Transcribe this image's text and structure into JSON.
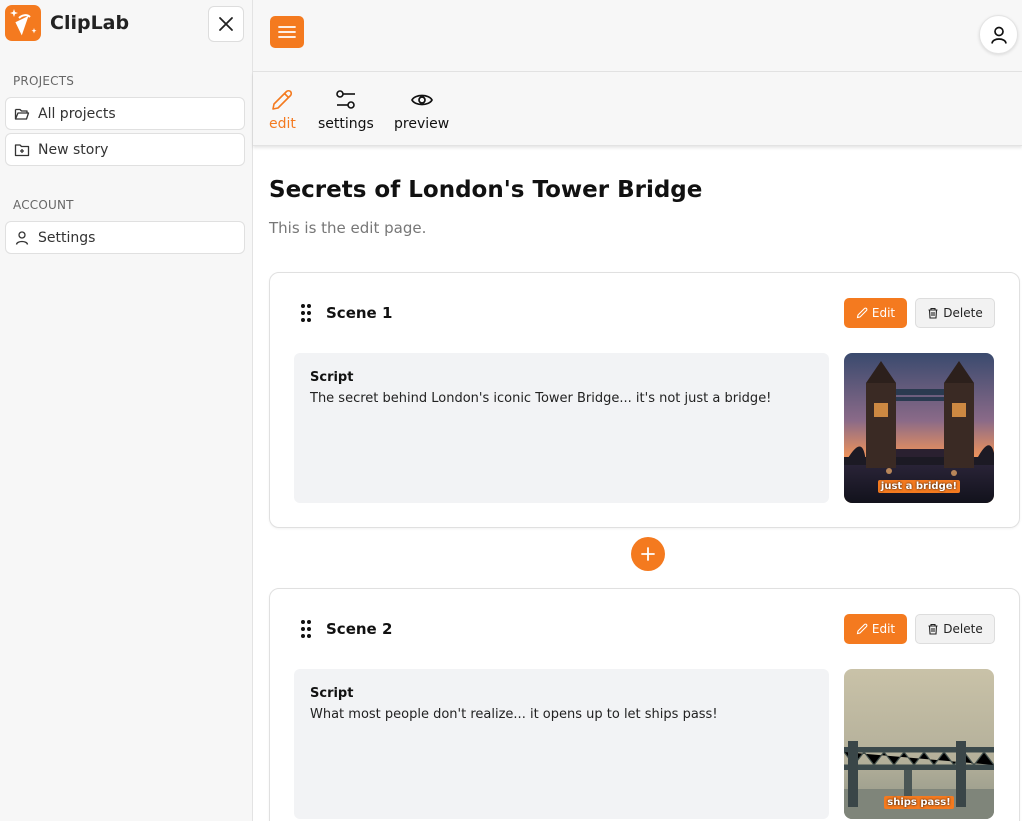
{
  "app": {
    "name": "ClipLab"
  },
  "sidebar": {
    "projects_label": "PROJECTS",
    "projects_items": [
      {
        "label": "All projects",
        "icon": "folder-open-icon"
      },
      {
        "label": "New story",
        "icon": "folder-plus-icon"
      }
    ],
    "account_label": "ACCOUNT",
    "account_items": [
      {
        "label": "Settings",
        "icon": "user-icon"
      }
    ]
  },
  "tabs": [
    {
      "label": "edit",
      "icon": "pencil-icon",
      "active": true
    },
    {
      "label": "settings",
      "icon": "sliders-icon",
      "active": false
    },
    {
      "label": "preview",
      "icon": "eye-icon",
      "active": false
    }
  ],
  "page": {
    "title": "Secrets of London's Tower Bridge",
    "subtitle": "This is the edit page."
  },
  "scenes": [
    {
      "title": "Scene 1",
      "edit_label": "Edit",
      "delete_label": "Delete",
      "script_label": "Script",
      "script_text": "The secret behind London's iconic Tower Bridge... it's not just a bridge!",
      "caption": "just a bridge!"
    },
    {
      "title": "Scene 2",
      "edit_label": "Edit",
      "delete_label": "Delete",
      "script_label": "Script",
      "script_text": "What most people don't realize... it opens up to let ships pass!",
      "caption": "ships pass!"
    }
  ],
  "colors": {
    "accent": "#f47a1f",
    "sidebar_bg": "#f7f7f7",
    "script_bg": "#f2f3f5"
  }
}
